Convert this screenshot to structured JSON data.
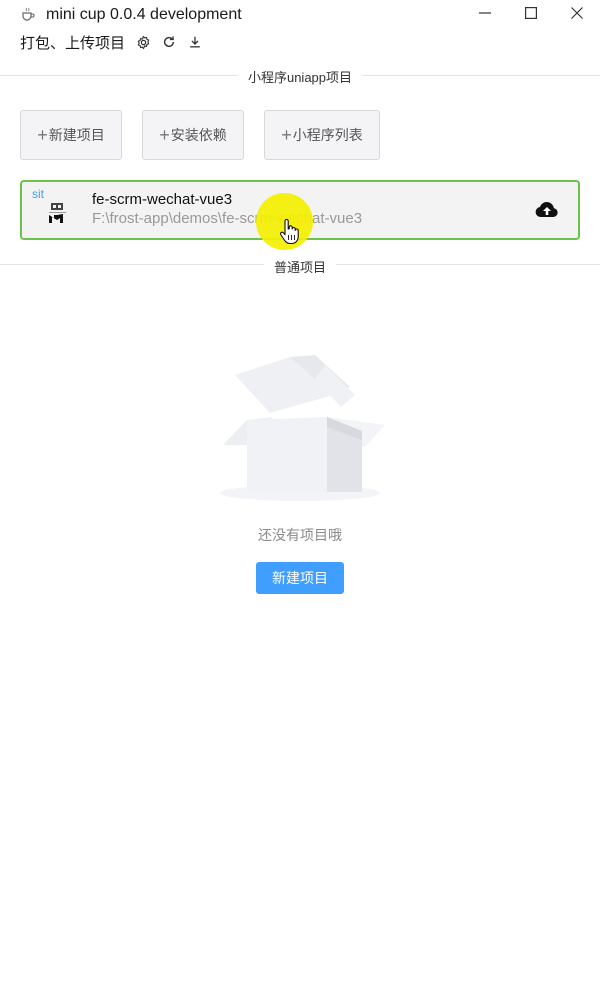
{
  "window": {
    "title": "mini cup 0.0.4 development",
    "icon": "coffee-cup-icon",
    "controls": [
      "minimize-icon",
      "maximize-icon",
      "close-icon"
    ]
  },
  "toolbar": {
    "title": "打包、上传项目",
    "icons": [
      "gear-icon",
      "refresh-icon",
      "download-icon"
    ]
  },
  "miniapp_section": {
    "label": "小程序uniapp项目",
    "buttons": [
      {
        "icon": "plus-icon",
        "label": "新建项目"
      },
      {
        "icon": "plus-icon",
        "label": "安装依赖"
      },
      {
        "icon": "plus-icon",
        "label": "小程序列表"
      }
    ],
    "projects": [
      {
        "env": "sit",
        "name": "fe-scrm-wechat-vue3",
        "path": "F:\\frost-app\\demos\\fe-scrm-wechat-vue3",
        "action_icon": "cloud-upload-icon"
      }
    ]
  },
  "normal_section": {
    "label": "普通项目",
    "empty_text": "还没有项目哦",
    "new_button": "新建项目"
  },
  "colors": {
    "accent": "#409eff",
    "selected_border": "#6cc24a",
    "cursor_highlight": "#f5f000"
  }
}
